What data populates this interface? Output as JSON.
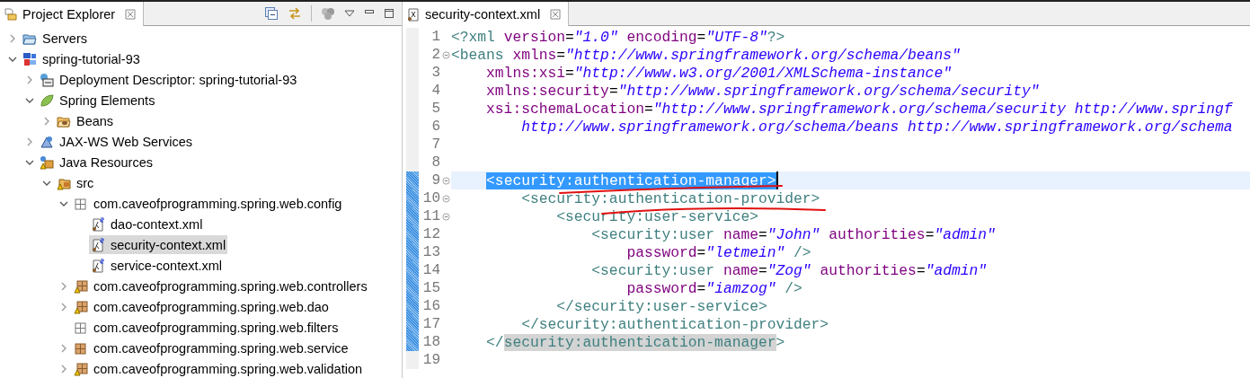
{
  "explorer": {
    "title": "Project Explorer",
    "tree": [
      {
        "label": "Servers",
        "kind": "folder",
        "expander": true,
        "expanded": false,
        "selected": false
      },
      {
        "label": "spring-tutorial-93",
        "kind": "web-project",
        "expander": true,
        "expanded": true,
        "selected": false,
        "children": [
          {
            "label": "Deployment Descriptor: spring-tutorial-93",
            "kind": "descriptor",
            "expander": true,
            "expanded": false,
            "selected": false
          },
          {
            "label": "Spring Elements",
            "kind": "leaf",
            "expander": true,
            "expanded": true,
            "selected": false,
            "children": [
              {
                "label": "Beans",
                "kind": "beans",
                "expander": true,
                "expanded": false,
                "selected": false
              }
            ]
          },
          {
            "label": "JAX-WS Web Services",
            "kind": "webservice",
            "expander": true,
            "expanded": false,
            "selected": false
          },
          {
            "label": "Java Resources",
            "kind": "java-resources",
            "expander": true,
            "expanded": true,
            "selected": false,
            "children": [
              {
                "label": "src",
                "kind": "source-folder",
                "expander": true,
                "expanded": true,
                "selected": false,
                "children": [
                  {
                    "label": "com.caveofprogramming.spring.web.config",
                    "kind": "package-open",
                    "expander": true,
                    "expanded": true,
                    "selected": false,
                    "children": [
                      {
                        "label": "dao-context.xml",
                        "kind": "spring-xml",
                        "expander": false,
                        "selected": false
                      },
                      {
                        "label": "security-context.xml",
                        "kind": "spring-xml",
                        "expander": false,
                        "selected": true
                      },
                      {
                        "label": "service-context.xml",
                        "kind": "spring-xml",
                        "expander": false,
                        "selected": false
                      }
                    ]
                  },
                  {
                    "label": "com.caveofprogramming.spring.web.controllers",
                    "kind": "package-warning",
                    "expander": true,
                    "expanded": false,
                    "selected": false
                  },
                  {
                    "label": "com.caveofprogramming.spring.web.dao",
                    "kind": "package-warning",
                    "expander": true,
                    "expanded": false,
                    "selected": false
                  },
                  {
                    "label": "com.caveofprogramming.spring.web.filters",
                    "kind": "package-empty",
                    "expander": false,
                    "selected": false
                  },
                  {
                    "label": "com.caveofprogramming.spring.web.service",
                    "kind": "package",
                    "expander": true,
                    "expanded": false,
                    "selected": false
                  },
                  {
                    "label": "com.caveofprogramming.spring.web.validation",
                    "kind": "package-warning",
                    "expander": true,
                    "expanded": false,
                    "selected": false
                  }
                ]
              }
            ]
          }
        ]
      }
    ]
  },
  "editor": {
    "tab": "security-context.xml",
    "lines": [
      {
        "no": "1",
        "fold": false,
        "changed": false,
        "current": false,
        "tokens": [
          {
            "kind": "tag",
            "t": "<?xml"
          },
          {
            "kind": "attr",
            "t": " version"
          },
          {
            "kind": "eq",
            "t": "="
          },
          {
            "kind": "val",
            "t": "\"1.0\""
          },
          {
            "kind": "attr",
            "t": " encoding"
          },
          {
            "kind": "eq",
            "t": "="
          },
          {
            "kind": "val",
            "t": "\"UTF-8\""
          },
          {
            "kind": "tag",
            "t": "?>"
          }
        ]
      },
      {
        "no": "2",
        "fold": true,
        "changed": false,
        "current": false,
        "tokens": [
          {
            "kind": "tag",
            "t": "<beans"
          },
          {
            "kind": "attr",
            "t": " xmlns"
          },
          {
            "kind": "eq",
            "t": "="
          },
          {
            "kind": "val",
            "t": "\"http://www.springframework.org/schema/beans\""
          }
        ]
      },
      {
        "no": "3",
        "fold": false,
        "changed": false,
        "current": false,
        "tokens": [
          {
            "kind": "attr",
            "t": "    xmlns:xsi"
          },
          {
            "kind": "eq",
            "t": "="
          },
          {
            "kind": "val",
            "t": "\"http://www.w3.org/2001/XMLSchema-instance\""
          }
        ]
      },
      {
        "no": "4",
        "fold": false,
        "changed": false,
        "current": false,
        "tokens": [
          {
            "kind": "attr",
            "t": "    xmlns:security"
          },
          {
            "kind": "eq",
            "t": "="
          },
          {
            "kind": "val",
            "t": "\"http://www.springframework.org/schema/security\""
          }
        ]
      },
      {
        "no": "5",
        "fold": false,
        "changed": false,
        "current": false,
        "tokens": [
          {
            "kind": "attr",
            "t": "    xsi:schemaLocation"
          },
          {
            "kind": "eq",
            "t": "="
          },
          {
            "kind": "val",
            "t": "\"http://www.springframework.org/schema/security http://www.springf"
          }
        ]
      },
      {
        "no": "6",
        "fold": false,
        "changed": false,
        "current": false,
        "tokens": [
          {
            "kind": "val",
            "t": "        http://www.springframework.org/schema/beans http://www.springframework.org/schema"
          }
        ]
      },
      {
        "no": "7",
        "fold": false,
        "changed": false,
        "current": false
      },
      {
        "no": "8",
        "fold": false,
        "changed": false,
        "current": false
      },
      {
        "no": "9",
        "fold": true,
        "changed": true,
        "current": true,
        "tokens": [
          {
            "kind": "tag",
            "t": "    <security:authentication-manager>",
            "selected": true
          }
        ]
      },
      {
        "no": "10",
        "fold": true,
        "changed": true,
        "current": false,
        "tokens": [
          {
            "kind": "tag",
            "t": "        <security:authentication-provider>"
          }
        ]
      },
      {
        "no": "11",
        "fold": true,
        "changed": true,
        "current": false,
        "tokens": [
          {
            "kind": "tag",
            "t": "            <security:user-service>"
          }
        ]
      },
      {
        "no": "12",
        "fold": false,
        "changed": true,
        "current": false,
        "tokens": [
          {
            "kind": "tag",
            "t": "                <security:user"
          },
          {
            "kind": "attr",
            "t": " name"
          },
          {
            "kind": "eq",
            "t": "="
          },
          {
            "kind": "val",
            "t": "\"John\""
          },
          {
            "kind": "attr",
            "t": " authorities"
          },
          {
            "kind": "eq",
            "t": "="
          },
          {
            "kind": "val",
            "t": "\"admin\""
          }
        ]
      },
      {
        "no": "13",
        "fold": false,
        "changed": true,
        "current": false,
        "tokens": [
          {
            "kind": "attr",
            "t": "                    password"
          },
          {
            "kind": "eq",
            "t": "="
          },
          {
            "kind": "val",
            "t": "\"letmein\""
          },
          {
            "kind": "tag",
            "t": " />"
          }
        ]
      },
      {
        "no": "14",
        "fold": false,
        "changed": true,
        "current": false,
        "tokens": [
          {
            "kind": "tag",
            "t": "                <security:user"
          },
          {
            "kind": "attr",
            "t": " name"
          },
          {
            "kind": "eq",
            "t": "="
          },
          {
            "kind": "val",
            "t": "\"Zog\""
          },
          {
            "kind": "attr",
            "t": " authorities"
          },
          {
            "kind": "eq",
            "t": "="
          },
          {
            "kind": "val",
            "t": "\"admin\""
          }
        ]
      },
      {
        "no": "15",
        "fold": false,
        "changed": true,
        "current": false,
        "tokens": [
          {
            "kind": "attr",
            "t": "                    password"
          },
          {
            "kind": "eq",
            "t": "="
          },
          {
            "kind": "val",
            "t": "\"iamzog\""
          },
          {
            "kind": "tag",
            "t": " />"
          }
        ]
      },
      {
        "no": "16",
        "fold": false,
        "changed": true,
        "current": false,
        "tokens": [
          {
            "kind": "tag",
            "t": "            </security:user-service>"
          }
        ]
      },
      {
        "no": "17",
        "fold": false,
        "changed": true,
        "current": false,
        "tokens": [
          {
            "kind": "tag",
            "t": "        </security:authentication-provider>"
          }
        ]
      },
      {
        "no": "18",
        "fold": false,
        "changed": true,
        "current": false,
        "tokens": [
          {
            "kind": "tag",
            "t": "    </"
          },
          {
            "kind": "tag",
            "t": "security:authentication-manager",
            "match_highlight": true
          },
          {
            "kind": "tag",
            "t": ">"
          }
        ]
      },
      {
        "no": "19",
        "fold": false,
        "changed": false,
        "current": false
      }
    ]
  }
}
